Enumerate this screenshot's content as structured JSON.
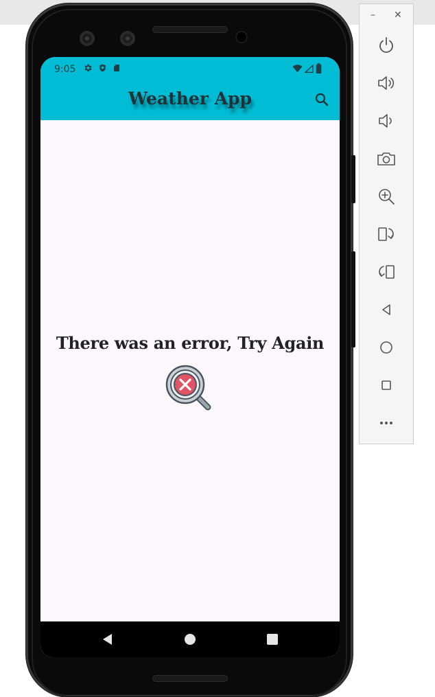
{
  "window": {
    "minimize_glyph": "–",
    "close_glyph": "✕"
  },
  "status_bar": {
    "time": "9:05",
    "left_icons": [
      "settings-icon",
      "shield-icon",
      "sd-card-icon"
    ],
    "right_icons": [
      "wifi-icon",
      "signal-icon",
      "battery-icon"
    ]
  },
  "app_bar": {
    "title": "Weather App",
    "action_icon": "search-icon"
  },
  "main": {
    "error_message": "There was an error, Try Again",
    "error_image": "magnifier-error-icon"
  },
  "nav_bar": {
    "buttons": [
      "back-icon",
      "home-icon",
      "recents-icon"
    ]
  },
  "emulator_controls": [
    "power-icon",
    "volume-up-icon",
    "volume-down-icon",
    "camera-icon",
    "zoom-icon",
    "rotate-left-icon",
    "rotate-right-icon",
    "back-icon",
    "home-icon",
    "overview-icon",
    "more-icon"
  ],
  "colors": {
    "app_bar": "#00bcd4",
    "screen_background": "#fcf7fc",
    "text_dark": "#222126",
    "error_red": "#e05565"
  }
}
